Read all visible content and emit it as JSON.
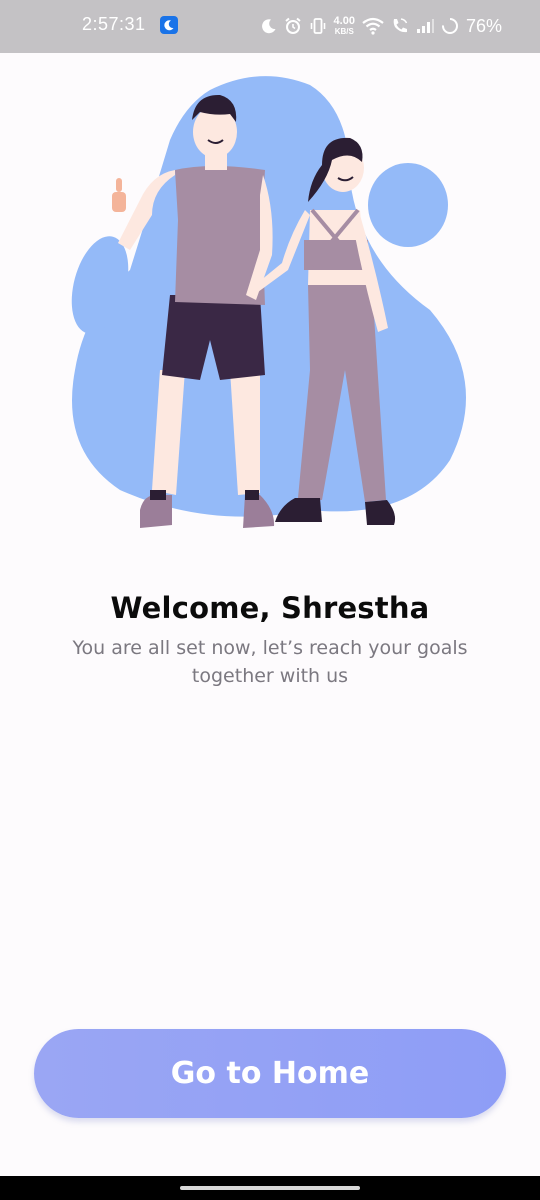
{
  "status_bar": {
    "time": "2:57:31",
    "net_speed_value": "4.00",
    "net_speed_unit": "KB/S",
    "battery_percent": "76%"
  },
  "welcome": {
    "title": "Welcome, Shrestha",
    "subtitle": "You are all set now, let’s reach your goals together with us"
  },
  "actions": {
    "go_home_label": "Go to Home"
  },
  "colors": {
    "accent": "#92A3F5",
    "blob": "#94BAF8",
    "status_bar": "#C4C2C5"
  }
}
